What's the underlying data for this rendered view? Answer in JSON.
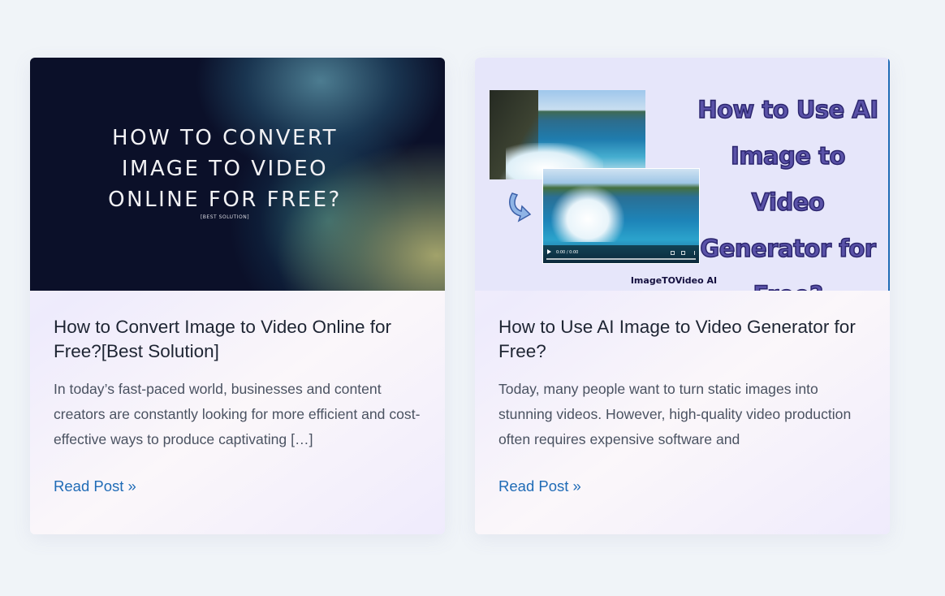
{
  "posts": [
    {
      "thumbnail": {
        "headline": "HOW TO CONVERT\nIMAGE TO VIDEO\nONLINE FOR FREE?",
        "subtitle": "[BEST SOLUTION]"
      },
      "title": "How to Convert Image to Video Online for Free?[Best Solution]",
      "excerpt": "In today’s fast-paced world, businesses and content creators are constantly looking for more efficient and cost-effective ways to produce captivating […]",
      "read_more": "Read Post »"
    },
    {
      "thumbnail": {
        "headline_lines": [
          "How to Use AI",
          "Image to Video",
          "Generator for",
          "Free?"
        ],
        "video_time": "0:00 / 0:00",
        "brand": "ImageTOVideo AI"
      },
      "title": "How to Use AI Image to Video Generator for Free?",
      "excerpt": "Today, many people want to turn static images into stunning videos. However, high-quality video production often requires expensive software and",
      "read_more": "Read Post »"
    }
  ],
  "colors": {
    "page_background": "#f0f4f8",
    "link": "#1f6bb6",
    "title_text": "#1e2533",
    "body_text": "#4a5261"
  },
  "icons": {
    "thumbnail_2_arrow": "curved-arrow-icon"
  }
}
